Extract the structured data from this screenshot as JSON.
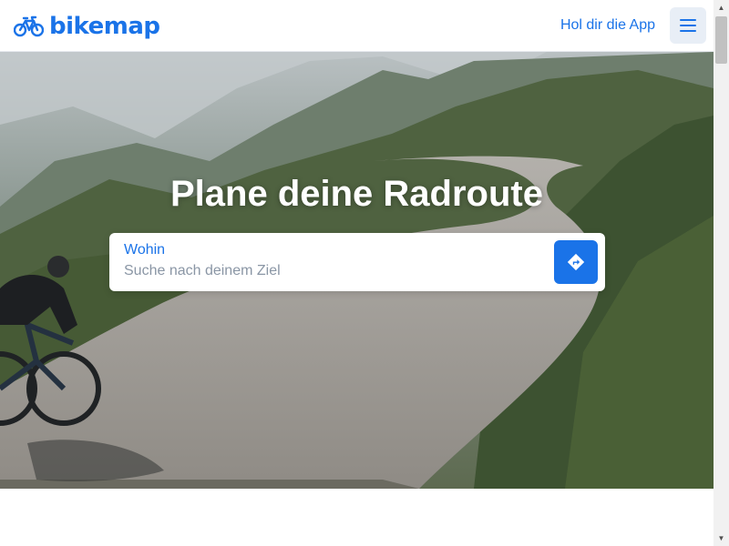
{
  "brand": {
    "name": "bikemap",
    "logo_icon": "bicycle-icon",
    "accent": "#1a73e8"
  },
  "header": {
    "app_link": "Hol dir die App",
    "menu_icon": "hamburger-menu-icon"
  },
  "hero": {
    "title": "Plane deine Radroute",
    "search": {
      "label": "Wohin",
      "placeholder": "Suche nach deinem Ziel",
      "value": "",
      "button_icon": "directions-icon"
    }
  },
  "scrollbar": {
    "up_icon": "scroll-up-arrow",
    "down_icon": "scroll-down-arrow"
  }
}
